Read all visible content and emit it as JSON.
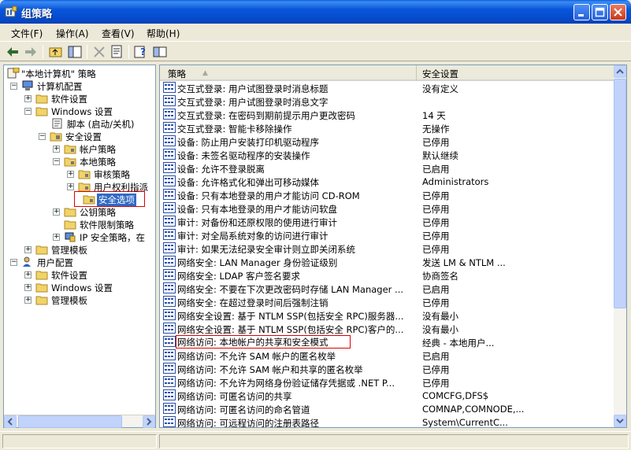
{
  "window": {
    "title": "组策略"
  },
  "menu": {
    "file": "文件(F)",
    "action": "操作(A)",
    "view": "查看(V)",
    "help": "帮助(H)"
  },
  "tree": {
    "root": "\"本地计算机\" 策略",
    "computer_config": "计算机配置",
    "software_settings": "软件设置",
    "windows_settings": "Windows 设置",
    "scripts": "脚本 (启动/关机)",
    "security_settings": "安全设置",
    "account_policies": "帐户策略",
    "local_policies": "本地策略",
    "audit_policy": "审核策略",
    "user_rights": "用户权利指派",
    "security_options": "安全选项",
    "public_key": "公钥策略",
    "software_restriction": "软件限制策略",
    "ip_security": "IP 安全策略，在",
    "admin_templates": "管理模板",
    "user_config": "用户配置",
    "user_software_settings": "软件设置",
    "user_windows_settings": "Windows 设置",
    "user_admin_templates": "管理模板"
  },
  "list": {
    "col_policy": "策略",
    "col_setting": "安全设置",
    "rows": [
      {
        "policy": "交互式登录: 用户试图登录时消息标题",
        "setting": "没有定义"
      },
      {
        "policy": "交互式登录: 用户试图登录时消息文字",
        "setting": ""
      },
      {
        "policy": "交互式登录: 在密码到期前提示用户更改密码",
        "setting": "14 天"
      },
      {
        "policy": "交互式登录: 智能卡移除操作",
        "setting": "无操作"
      },
      {
        "policy": "设备: 防止用户安装打印机驱动程序",
        "setting": "已停用"
      },
      {
        "policy": "设备: 未签名驱动程序的安装操作",
        "setting": "默认继续"
      },
      {
        "policy": "设备: 允许不登录脱离",
        "setting": "已启用"
      },
      {
        "policy": "设备: 允许格式化和弹出可移动媒体",
        "setting": "Administrators"
      },
      {
        "policy": "设备: 只有本地登录的用户才能访问 CD-ROM",
        "setting": "已停用"
      },
      {
        "policy": "设备: 只有本地登录的用户才能访问软盘",
        "setting": "已停用"
      },
      {
        "policy": "审计: 对备份和还原权限的使用进行审计",
        "setting": "已停用"
      },
      {
        "policy": "审计: 对全局系统对象的访问进行审计",
        "setting": "已停用"
      },
      {
        "policy": "审计: 如果无法纪录安全审计则立即关闭系统",
        "setting": "已停用"
      },
      {
        "policy": "网络安全: LAN Manager 身份验证级别",
        "setting": "发送 LM & NTLM ..."
      },
      {
        "policy": "网络安全: LDAP 客户签名要求",
        "setting": "协商签名"
      },
      {
        "policy": "网络安全: 不要在下次更改密码时存储 LAN Manager ...",
        "setting": "已启用"
      },
      {
        "policy": "网络安全: 在超过登录时间后强制注销",
        "setting": "已停用"
      },
      {
        "policy": "网络安全设置: 基于 NTLM SSP(包括安全 RPC)服务器...",
        "setting": "没有最小"
      },
      {
        "policy": "网络安全设置: 基于 NTLM SSP(包括安全 RPC)客户的...",
        "setting": "没有最小"
      },
      {
        "policy": "网络访问: 本地帐户的共享和安全模式",
        "setting": "经典 - 本地用户..."
      },
      {
        "policy": "网络访问: 不允许 SAM 帐户的匿名枚举",
        "setting": "已启用"
      },
      {
        "policy": "网络访问: 不允许 SAM 帐户和共享的匿名枚举",
        "setting": "已停用"
      },
      {
        "policy": "网络访问: 不允许为网络身份验证储存凭据或 .NET P...",
        "setting": "已停用"
      },
      {
        "policy": "网络访问: 可匿名访问的共享",
        "setting": "COMCFG,DFS$"
      },
      {
        "policy": "网络访问: 可匿名访问的命名管道",
        "setting": "COMNAP,COMNODE,..."
      },
      {
        "policy": "网络访问: 可远程访问的注册表路径",
        "setting": "System\\CurrentC..."
      }
    ]
  },
  "colors": {
    "selection": "#316AC5",
    "highlight_box": "#E00000",
    "title_blue": "#0856DB"
  }
}
